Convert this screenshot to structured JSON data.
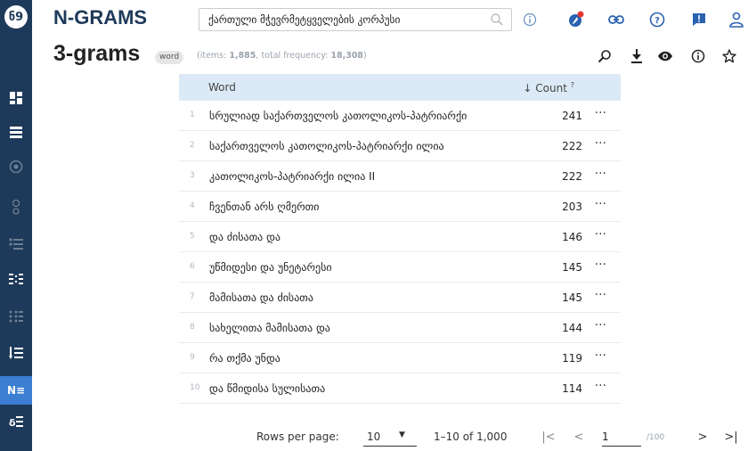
{
  "app": {
    "logo_text": "ნ9",
    "title": "N-GRAMS"
  },
  "search": {
    "value": "ქართული მჭევრმეტყველების კორპუსი"
  },
  "page": {
    "title": "3-grams",
    "badge": "word",
    "stats_prefix": "(items: ",
    "items": "1,885",
    "stats_mid": ", total frequency: ",
    "total_frequency": "18,308",
    "stats_suffix": ")"
  },
  "sidebar": {
    "active_label": "N≡",
    "items": [
      {
        "icon": "dashboard-icon"
      },
      {
        "icon": "list-icon"
      },
      {
        "icon": "circle-dot-icon"
      },
      {
        "icon": "nodes-icon"
      },
      {
        "icon": "bullet-list-icon"
      },
      {
        "icon": "columns-icon"
      },
      {
        "icon": "grid-dots-icon"
      },
      {
        "icon": "sort-list-icon"
      },
      {
        "icon": "ngrams-icon"
      },
      {
        "icon": "sort-alpha-icon"
      }
    ]
  },
  "table": {
    "col_word": "Word",
    "col_count": "↓ Count",
    "col_count_help": "?",
    "more_label": "···",
    "rows": [
      {
        "n": "1",
        "word": "სრულიად საქართველოს კათოლიკოს-პატრიარქი",
        "count": "241"
      },
      {
        "n": "2",
        "word": "საქართველოს კათოლიკოს-პატრიარქი ილია",
        "count": "222"
      },
      {
        "n": "3",
        "word": "კათოლიკოს-პატრიარქი ილია II",
        "count": "222"
      },
      {
        "n": "4",
        "word": "ჩვენთან არს ღმერთი",
        "count": "203"
      },
      {
        "n": "5",
        "word": "და ძისათა და",
        "count": "146"
      },
      {
        "n": "6",
        "word": "უწმიდესი და უნეტარესი",
        "count": "145"
      },
      {
        "n": "7",
        "word": "მამისათა და ძისათა",
        "count": "145"
      },
      {
        "n": "8",
        "word": "სახელითა მამისათა და",
        "count": "144"
      },
      {
        "n": "9",
        "word": "რა თქმა უნდა",
        "count": "119"
      },
      {
        "n": "10",
        "word": "და წმიდისა სულისათა",
        "count": "114"
      }
    ]
  },
  "pagination": {
    "rows_per_page_label": "Rows per page:",
    "rows_per_page": "10",
    "range": "1–10 of 1,000",
    "current_page": "1",
    "total_pages": "/100"
  },
  "colors": {
    "sidebar_bg": "#1e3a5a",
    "active_item": "#3c7fd2",
    "table_header": "#dbeaf6",
    "notification_dot": "#e53935"
  }
}
